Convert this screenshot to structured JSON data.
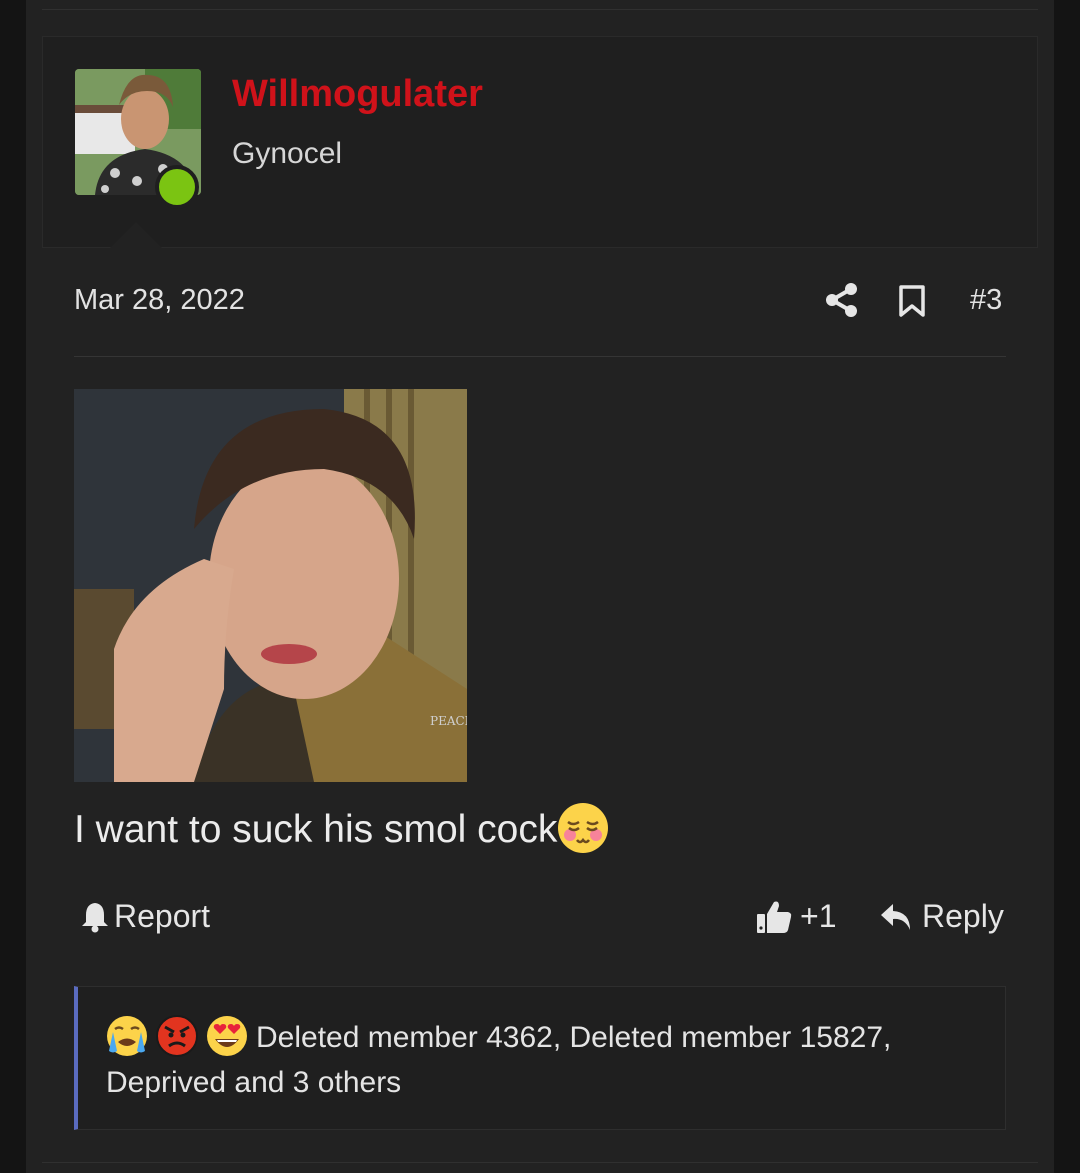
{
  "user": {
    "name": "Willmogulater",
    "title": "Gynocel",
    "name_color": "#d0121a",
    "online_color": "#7bc412"
  },
  "post": {
    "date": "Mar 28, 2022",
    "number": "#3",
    "text": "I want to suck his smol cock",
    "image_watermark": "PEACH"
  },
  "actions": {
    "report_label": "Report",
    "like_label": "+1",
    "reply_label": "Reply"
  },
  "reactions": {
    "icons": [
      "crying-emoji",
      "angry-emoji",
      "heart-eyes-emoji"
    ],
    "summary": "Deleted member 4362, Deleted member 15827, Deprived and 3 others"
  },
  "icons": {
    "share": "share-icon",
    "bookmark": "bookmark-icon",
    "report": "bell-icon",
    "like": "thumbs-up-icon",
    "reply": "reply-arrow-icon"
  }
}
